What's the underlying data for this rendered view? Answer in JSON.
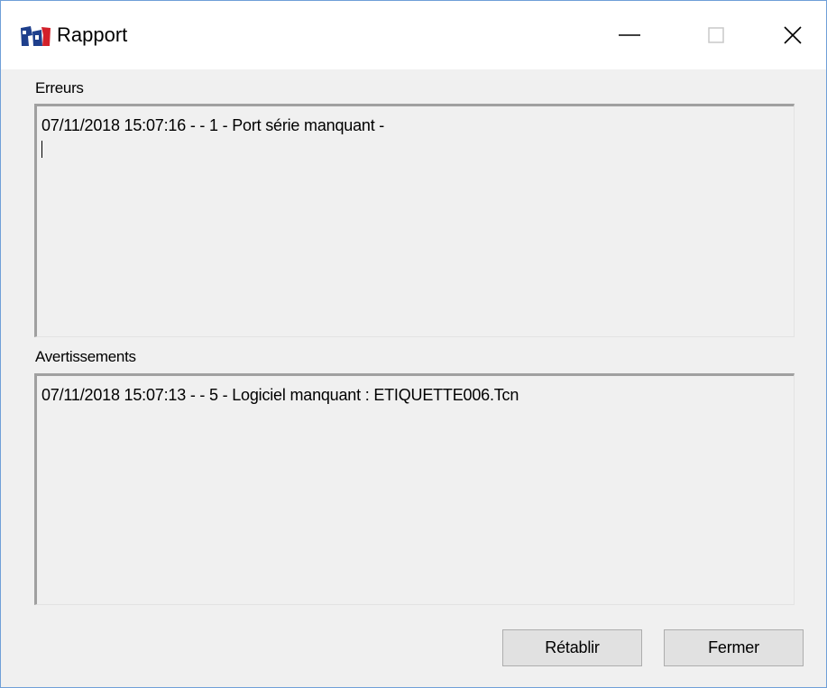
{
  "window": {
    "title": "Rapport",
    "accent_border_color": "#6f9fd8",
    "app_icon": "application-logo-icon",
    "controls": {
      "minimize": "minimize-icon",
      "maximize": "maximize-icon",
      "close": "close-icon"
    }
  },
  "errors": {
    "label": "Erreurs",
    "lines": [
      "07/11/2018 15:07:16 -  - 1 - Port série manquant -"
    ]
  },
  "warnings": {
    "label": "Avertissements",
    "lines": [
      "07/11/2018 15:07:13 -  - 5 - Logiciel manquant : ETIQUETTE006.Tcn"
    ]
  },
  "buttons": {
    "reset_label": "Rétablir",
    "close_label": "Fermer"
  }
}
